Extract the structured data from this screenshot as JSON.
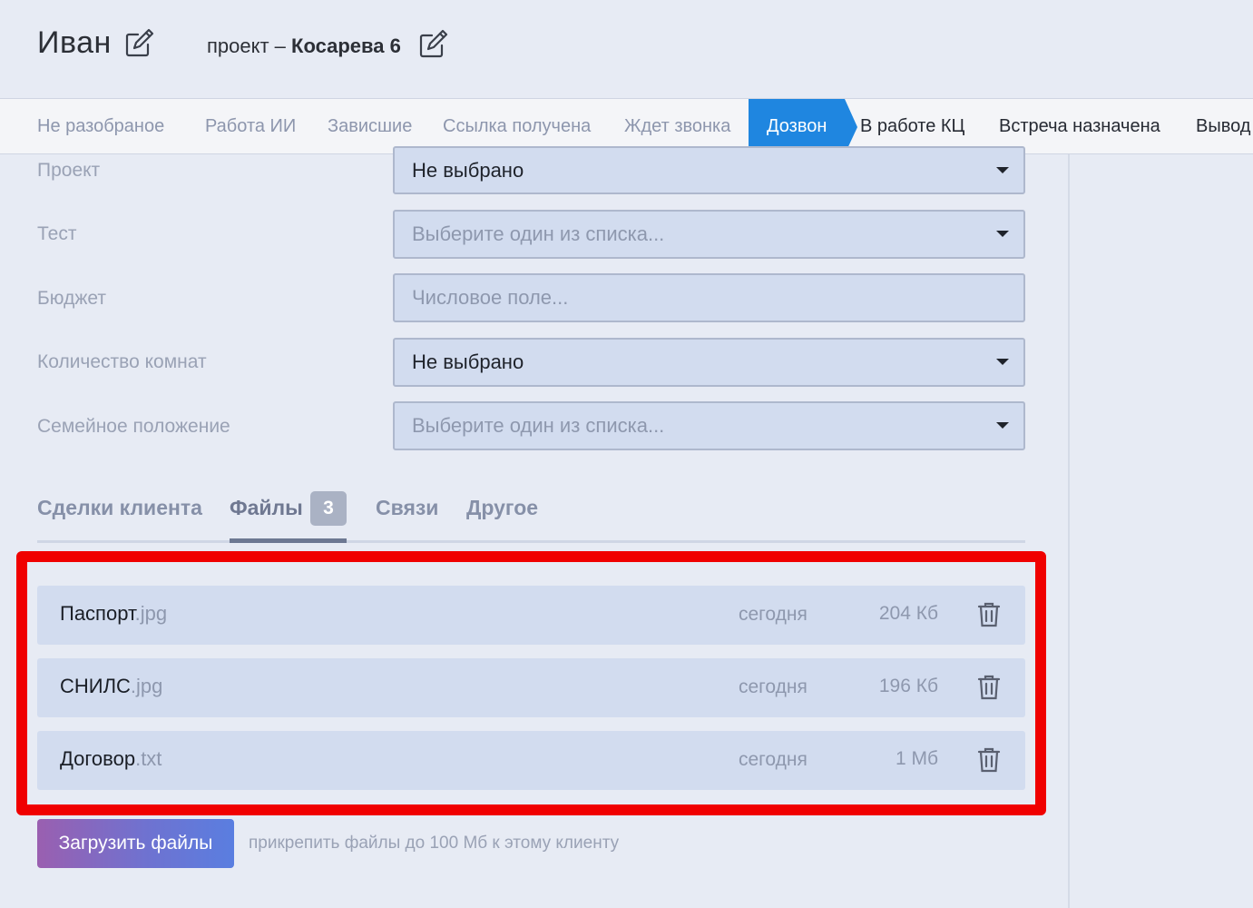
{
  "header": {
    "client_name": "Иван",
    "project_prefix": "проект – ",
    "project_name": "Косарева 6"
  },
  "stages": {
    "items": [
      {
        "label": "Не разобраное",
        "state": "past"
      },
      {
        "label": "Работа ИИ",
        "state": "past"
      },
      {
        "label": "Зависшие",
        "state": "past"
      },
      {
        "label": "Ссылка получена",
        "state": "past"
      },
      {
        "label": "Ждет звонка",
        "state": "past"
      },
      {
        "label": "Дозвон",
        "state": "active"
      },
      {
        "label": "В работе КЦ",
        "state": "future"
      },
      {
        "label": "Встреча назначена",
        "state": "future"
      },
      {
        "label": "Вывод",
        "state": "future"
      }
    ],
    "active_color": "#1f86e0"
  },
  "form": {
    "fields": [
      {
        "label": "Проект",
        "value": "Не выбрано",
        "kind": "select"
      },
      {
        "label": "Тест",
        "placeholder": "Выберите один из списка...",
        "kind": "select"
      },
      {
        "label": "Бюджет",
        "placeholder": "Числовое поле...",
        "kind": "number"
      },
      {
        "label": "Количество комнат",
        "value": "Не выбрано",
        "kind": "select"
      },
      {
        "label": "Семейное положение",
        "placeholder": "Выберите один из списка...",
        "kind": "select"
      }
    ]
  },
  "tabs": {
    "items": [
      {
        "label": "Сделки клиента"
      },
      {
        "label": "Файлы",
        "badge": "3",
        "active": true
      },
      {
        "label": "Связи"
      },
      {
        "label": "Другое"
      }
    ]
  },
  "files": [
    {
      "name": "Паспорт",
      "ext": ".jpg",
      "date": "сегодня",
      "size": "204 Кб"
    },
    {
      "name": "СНИЛС",
      "ext": ".jpg",
      "date": "сегодня",
      "size": "196 Кб"
    },
    {
      "name": "Договор",
      "ext": ".txt",
      "date": "сегодня",
      "size": "1 Мб"
    }
  ],
  "upload": {
    "button_label": "Загрузить файлы",
    "hint": "прикрепить файлы до 100 Мб к этому клиенту"
  },
  "highlight_color": "#f00000"
}
